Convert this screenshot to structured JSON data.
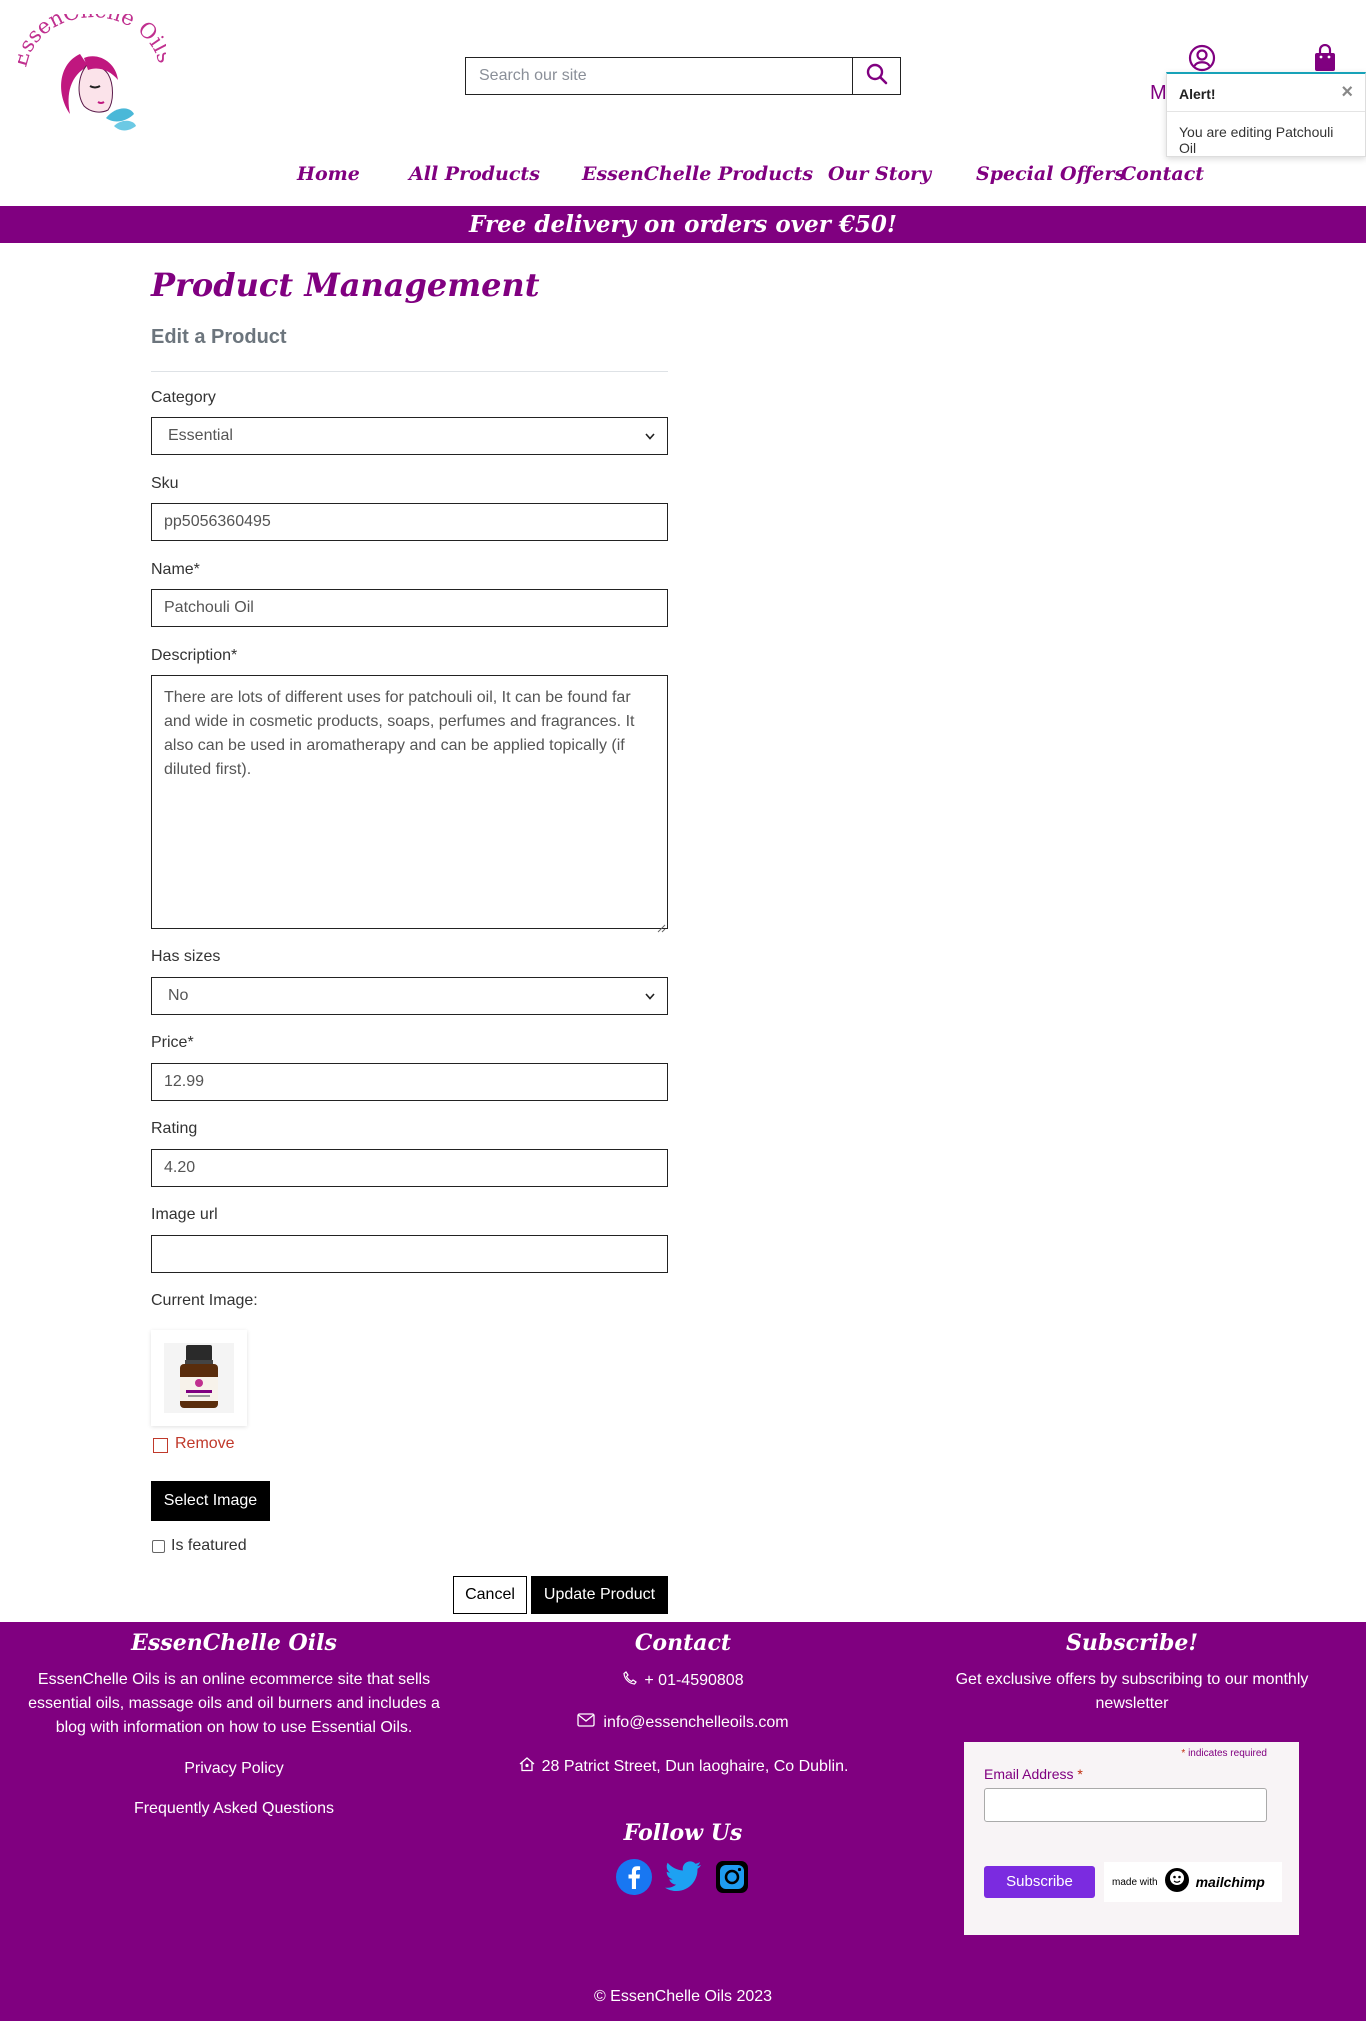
{
  "header": {
    "logo_text": "EssenChelle Oils",
    "search_placeholder": "Search our site",
    "account_label": "M"
  },
  "alert": {
    "title": "Alert!",
    "close": "×",
    "message": "You are editing Patchouli Oil"
  },
  "nav": {
    "items": [
      "Home",
      "All Products",
      "EssenChelle Products",
      "Our Story",
      "Special Offers",
      "Contact"
    ]
  },
  "banner": {
    "text": "Free delivery on orders over €50!"
  },
  "form": {
    "page_title": "Product Management",
    "subtitle": "Edit a Product",
    "category": {
      "label": "Category",
      "value": "Essential"
    },
    "sku": {
      "label": "Sku",
      "value": "pp5056360495"
    },
    "name": {
      "label": "Name*",
      "value": "Patchouli Oil"
    },
    "description": {
      "label": "Description*",
      "value": "There are lots of different uses for patchouli oil, It can be found far and wide in cosmetic products, soaps, perfumes and fragrances. It also can be used in aromatherapy and can be applied topically (if diluted first)."
    },
    "has_sizes": {
      "label": "Has sizes",
      "value": "No"
    },
    "price": {
      "label": "Price*",
      "value": "12.99"
    },
    "rating": {
      "label": "Rating",
      "value": "4.20"
    },
    "image_url": {
      "label": "Image url",
      "value": ""
    },
    "current_image_label": "Current Image:",
    "remove_label": "Remove",
    "select_image_label": "Select Image",
    "is_featured_label": "Is featured",
    "cancel_label": "Cancel",
    "update_label": "Update Product"
  },
  "footer": {
    "about": {
      "title": "EssenChelle Oils",
      "text": "EssenChelle Oils is an online ecommerce site that sells essential oils, massage oils and oil burners and includes a blog with information on how to use Essential Oils.",
      "links": [
        "Privacy Policy",
        "Frequently Asked Questions"
      ]
    },
    "contact": {
      "title": "Contact",
      "phone": "+ 01-4590808",
      "email": "info@essenchelleoils.com",
      "address": "28 Patrict Street, Dun laoghaire, Co Dublin.",
      "follow_title": "Follow Us"
    },
    "subscribe": {
      "title": "Subscribe!",
      "text": "Get exclusive offers by subscribing to our monthly newsletter",
      "required_note": "indicates required",
      "email_label": "Email Address",
      "button": "Subscribe",
      "made_with": "made with",
      "mailchimp": "mailchimp"
    },
    "copyright": "© EssenChelle Oils 2023"
  },
  "colors": {
    "brand": "#800080",
    "subscribe_button": "#7b2be0"
  }
}
